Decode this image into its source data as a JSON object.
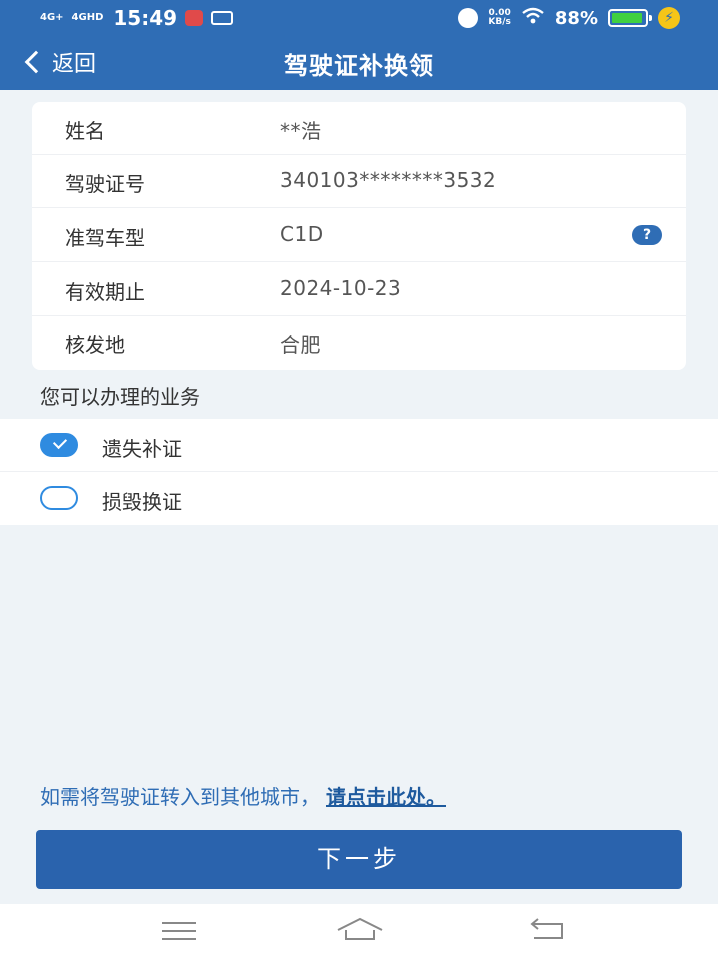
{
  "status_bar": {
    "signal_1": "4G+",
    "signal_2": "4GHD",
    "time": "15:49",
    "speed_value": "0.00",
    "speed_unit": "KB/s",
    "battery_pct": "88%"
  },
  "nav": {
    "back_label": "返回",
    "title": "驾驶证补换领"
  },
  "info": {
    "rows": [
      {
        "key": "姓名",
        "value": "**浩"
      },
      {
        "key": "驾驶证号",
        "value": "340103********3532"
      },
      {
        "key": "准驾车型",
        "value": "C1D"
      },
      {
        "key": "有效期止",
        "value": "2024-10-23"
      },
      {
        "key": "核发地",
        "value": "合肥"
      }
    ],
    "help_label": "?"
  },
  "services": {
    "label": "您可以办理的业务",
    "options": [
      {
        "label": "遗失补证",
        "checked": true
      },
      {
        "label": "损毁换证",
        "checked": false
      }
    ]
  },
  "transfer": {
    "text": "如需将驾驶证转入到其他城市，",
    "link": "请点击此处。"
  },
  "next_button": "下一步",
  "colors": {
    "primary": "#2f6db5",
    "button": "#2a63ad",
    "check": "#2f8be0",
    "background": "#eef3f7"
  }
}
